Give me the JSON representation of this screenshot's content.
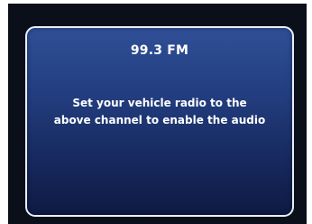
{
  "radio_dialog": {
    "channel": "99.3 FM",
    "message_line1": "Set your vehicle radio to the",
    "message_line2": "above channel to enable the audio"
  },
  "colors": {
    "screen_background": "#0b0f1a",
    "panel_top": "#2f4f96",
    "panel_bottom": "#0d1a43",
    "panel_border": "#e9eef7",
    "text": "#ffffff"
  }
}
